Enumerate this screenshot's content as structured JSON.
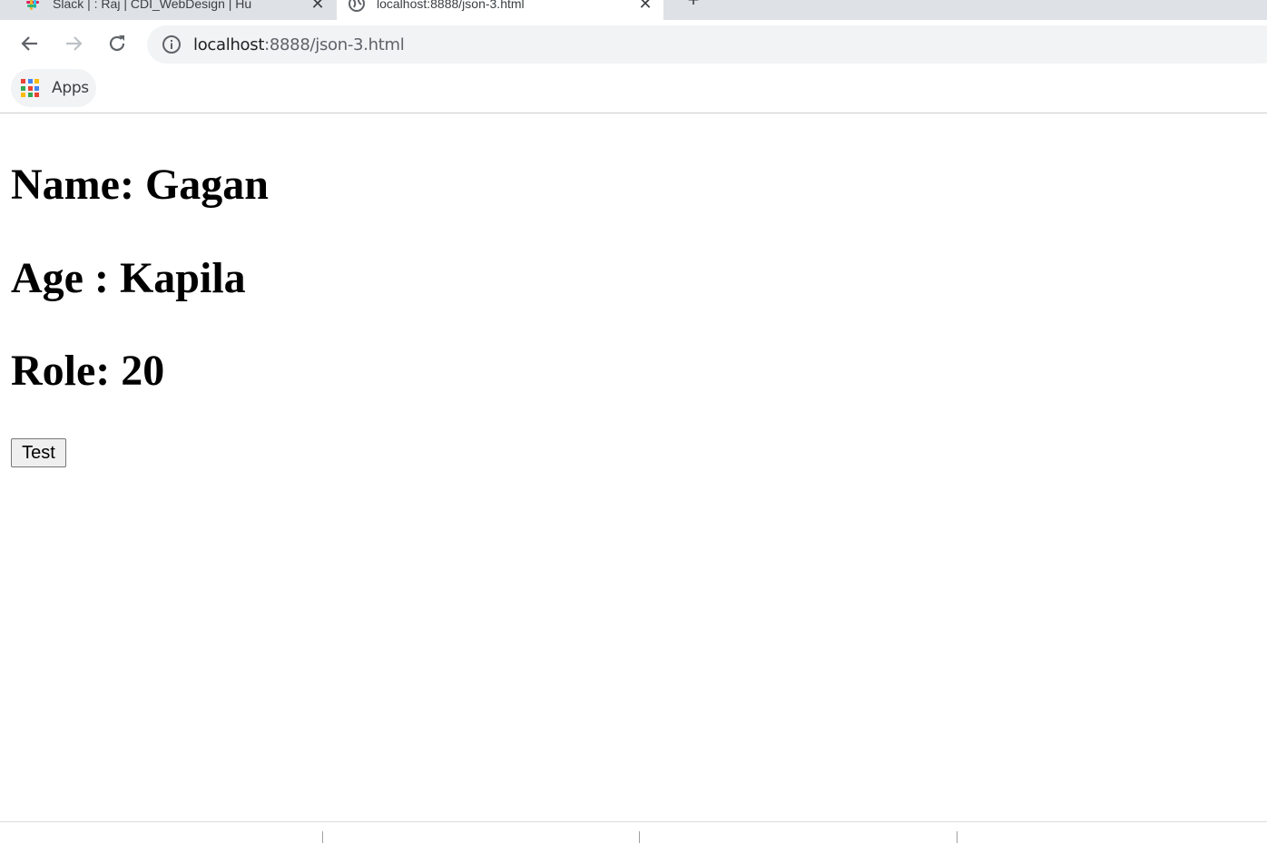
{
  "tabs": [
    {
      "title": "Slack | : Raj | CDI_WebDesign | Hu",
      "active": false
    },
    {
      "title": "localhost:8888/json-3.html",
      "active": true
    }
  ],
  "toolbar": {
    "url_host": "localhost",
    "url_path": ":8888/json-3.html"
  },
  "bookmarks": {
    "apps_label": "Apps"
  },
  "content": {
    "name_line": "Name: Gagan",
    "age_line": "Age : Kapila",
    "role_line": "Role: 20",
    "button_label": "Test"
  },
  "colors": {
    "apps_grid": [
      "#ea4335",
      "#4285f4",
      "#fbbc04",
      "#34a853",
      "#ea4335",
      "#4285f4",
      "#fbbc04",
      "#34a853",
      "#ea4335"
    ]
  }
}
